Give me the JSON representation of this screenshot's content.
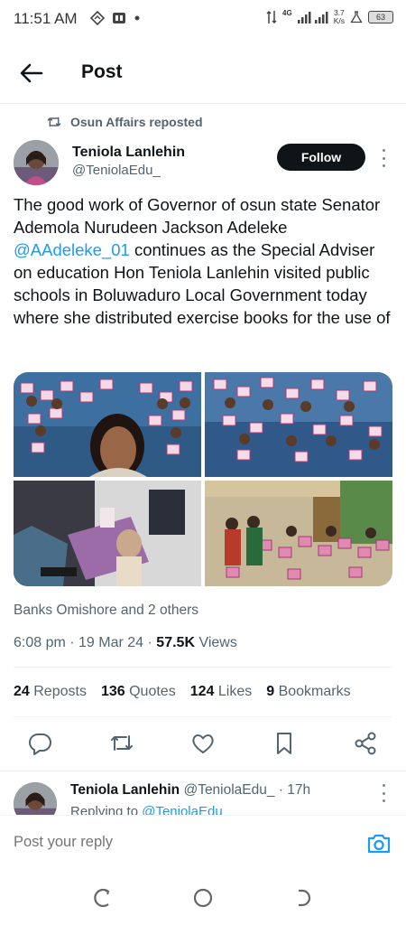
{
  "status": {
    "time": "11:51 AM",
    "network": "4G",
    "speed_value": "3.7",
    "speed_unit": "K/s",
    "battery": "63"
  },
  "header": {
    "title": "Post"
  },
  "repost": {
    "text": "Osun Affairs reposted"
  },
  "author": {
    "name": "Teniola Lanlehin",
    "handle": "@TeniolaEdu_",
    "follow_label": "Follow"
  },
  "tweet": {
    "text_before": "The good work of Governor of osun state Senator Ademola Nurudeen Jackson Adeleke ",
    "mention": "@AAdeleke_01",
    "text_after": " continues as the Special Adviser on education Hon Teniola Lanlehin visited public schools in Boluwaduro  Local Government today where she distributed exercise books for the use of"
  },
  "liked_by": "Banks Omishore and 2 others",
  "meta": {
    "time": "6:08 pm",
    "date": "19 Mar 24",
    "views_count": "57.5K",
    "views_label": "Views"
  },
  "stats": [
    {
      "count": "24",
      "label": "Reposts"
    },
    {
      "count": "136",
      "label": "Quotes"
    },
    {
      "count": "124",
      "label": "Likes"
    },
    {
      "count": "9",
      "label": "Bookmarks"
    }
  ],
  "reply": {
    "name": "Teniola Lanlehin",
    "handle": "@TeniolaEdu_",
    "time": "· 17h",
    "replying_prefix": "Replying to",
    "replying_handle": "@TeniolaEdu"
  },
  "compose": {
    "placeholder": "Post your reply"
  },
  "colors": {
    "accent": "#1d9bf0",
    "text": "#0f1419",
    "muted": "#536471",
    "follow_bg": "#0f1419"
  }
}
